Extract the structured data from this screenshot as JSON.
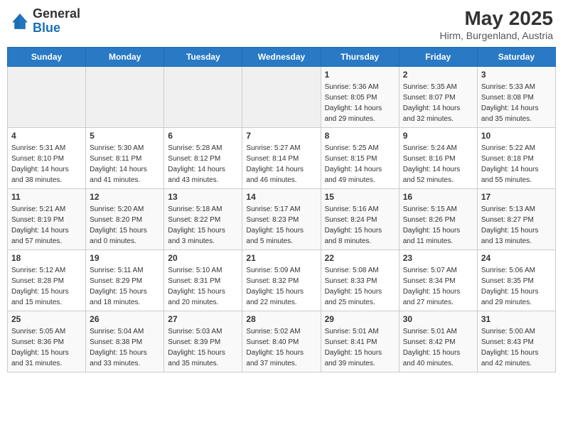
{
  "header": {
    "logo_general": "General",
    "logo_blue": "Blue",
    "month_year": "May 2025",
    "location": "Hirm, Burgenland, Austria"
  },
  "days_of_week": [
    "Sunday",
    "Monday",
    "Tuesday",
    "Wednesday",
    "Thursday",
    "Friday",
    "Saturday"
  ],
  "weeks": [
    [
      {
        "day": "",
        "info": ""
      },
      {
        "day": "",
        "info": ""
      },
      {
        "day": "",
        "info": ""
      },
      {
        "day": "",
        "info": ""
      },
      {
        "day": "1",
        "info": "Sunrise: 5:36 AM\nSunset: 8:05 PM\nDaylight: 14 hours\nand 29 minutes."
      },
      {
        "day": "2",
        "info": "Sunrise: 5:35 AM\nSunset: 8:07 PM\nDaylight: 14 hours\nand 32 minutes."
      },
      {
        "day": "3",
        "info": "Sunrise: 5:33 AM\nSunset: 8:08 PM\nDaylight: 14 hours\nand 35 minutes."
      }
    ],
    [
      {
        "day": "4",
        "info": "Sunrise: 5:31 AM\nSunset: 8:10 PM\nDaylight: 14 hours\nand 38 minutes."
      },
      {
        "day": "5",
        "info": "Sunrise: 5:30 AM\nSunset: 8:11 PM\nDaylight: 14 hours\nand 41 minutes."
      },
      {
        "day": "6",
        "info": "Sunrise: 5:28 AM\nSunset: 8:12 PM\nDaylight: 14 hours\nand 43 minutes."
      },
      {
        "day": "7",
        "info": "Sunrise: 5:27 AM\nSunset: 8:14 PM\nDaylight: 14 hours\nand 46 minutes."
      },
      {
        "day": "8",
        "info": "Sunrise: 5:25 AM\nSunset: 8:15 PM\nDaylight: 14 hours\nand 49 minutes."
      },
      {
        "day": "9",
        "info": "Sunrise: 5:24 AM\nSunset: 8:16 PM\nDaylight: 14 hours\nand 52 minutes."
      },
      {
        "day": "10",
        "info": "Sunrise: 5:22 AM\nSunset: 8:18 PM\nDaylight: 14 hours\nand 55 minutes."
      }
    ],
    [
      {
        "day": "11",
        "info": "Sunrise: 5:21 AM\nSunset: 8:19 PM\nDaylight: 14 hours\nand 57 minutes."
      },
      {
        "day": "12",
        "info": "Sunrise: 5:20 AM\nSunset: 8:20 PM\nDaylight: 15 hours\nand 0 minutes."
      },
      {
        "day": "13",
        "info": "Sunrise: 5:18 AM\nSunset: 8:22 PM\nDaylight: 15 hours\nand 3 minutes."
      },
      {
        "day": "14",
        "info": "Sunrise: 5:17 AM\nSunset: 8:23 PM\nDaylight: 15 hours\nand 5 minutes."
      },
      {
        "day": "15",
        "info": "Sunrise: 5:16 AM\nSunset: 8:24 PM\nDaylight: 15 hours\nand 8 minutes."
      },
      {
        "day": "16",
        "info": "Sunrise: 5:15 AM\nSunset: 8:26 PM\nDaylight: 15 hours\nand 11 minutes."
      },
      {
        "day": "17",
        "info": "Sunrise: 5:13 AM\nSunset: 8:27 PM\nDaylight: 15 hours\nand 13 minutes."
      }
    ],
    [
      {
        "day": "18",
        "info": "Sunrise: 5:12 AM\nSunset: 8:28 PM\nDaylight: 15 hours\nand 15 minutes."
      },
      {
        "day": "19",
        "info": "Sunrise: 5:11 AM\nSunset: 8:29 PM\nDaylight: 15 hours\nand 18 minutes."
      },
      {
        "day": "20",
        "info": "Sunrise: 5:10 AM\nSunset: 8:31 PM\nDaylight: 15 hours\nand 20 minutes."
      },
      {
        "day": "21",
        "info": "Sunrise: 5:09 AM\nSunset: 8:32 PM\nDaylight: 15 hours\nand 22 minutes."
      },
      {
        "day": "22",
        "info": "Sunrise: 5:08 AM\nSunset: 8:33 PM\nDaylight: 15 hours\nand 25 minutes."
      },
      {
        "day": "23",
        "info": "Sunrise: 5:07 AM\nSunset: 8:34 PM\nDaylight: 15 hours\nand 27 minutes."
      },
      {
        "day": "24",
        "info": "Sunrise: 5:06 AM\nSunset: 8:35 PM\nDaylight: 15 hours\nand 29 minutes."
      }
    ],
    [
      {
        "day": "25",
        "info": "Sunrise: 5:05 AM\nSunset: 8:36 PM\nDaylight: 15 hours\nand 31 minutes."
      },
      {
        "day": "26",
        "info": "Sunrise: 5:04 AM\nSunset: 8:38 PM\nDaylight: 15 hours\nand 33 minutes."
      },
      {
        "day": "27",
        "info": "Sunrise: 5:03 AM\nSunset: 8:39 PM\nDaylight: 15 hours\nand 35 minutes."
      },
      {
        "day": "28",
        "info": "Sunrise: 5:02 AM\nSunset: 8:40 PM\nDaylight: 15 hours\nand 37 minutes."
      },
      {
        "day": "29",
        "info": "Sunrise: 5:01 AM\nSunset: 8:41 PM\nDaylight: 15 hours\nand 39 minutes."
      },
      {
        "day": "30",
        "info": "Sunrise: 5:01 AM\nSunset: 8:42 PM\nDaylight: 15 hours\nand 40 minutes."
      },
      {
        "day": "31",
        "info": "Sunrise: 5:00 AM\nSunset: 8:43 PM\nDaylight: 15 hours\nand 42 minutes."
      }
    ]
  ]
}
